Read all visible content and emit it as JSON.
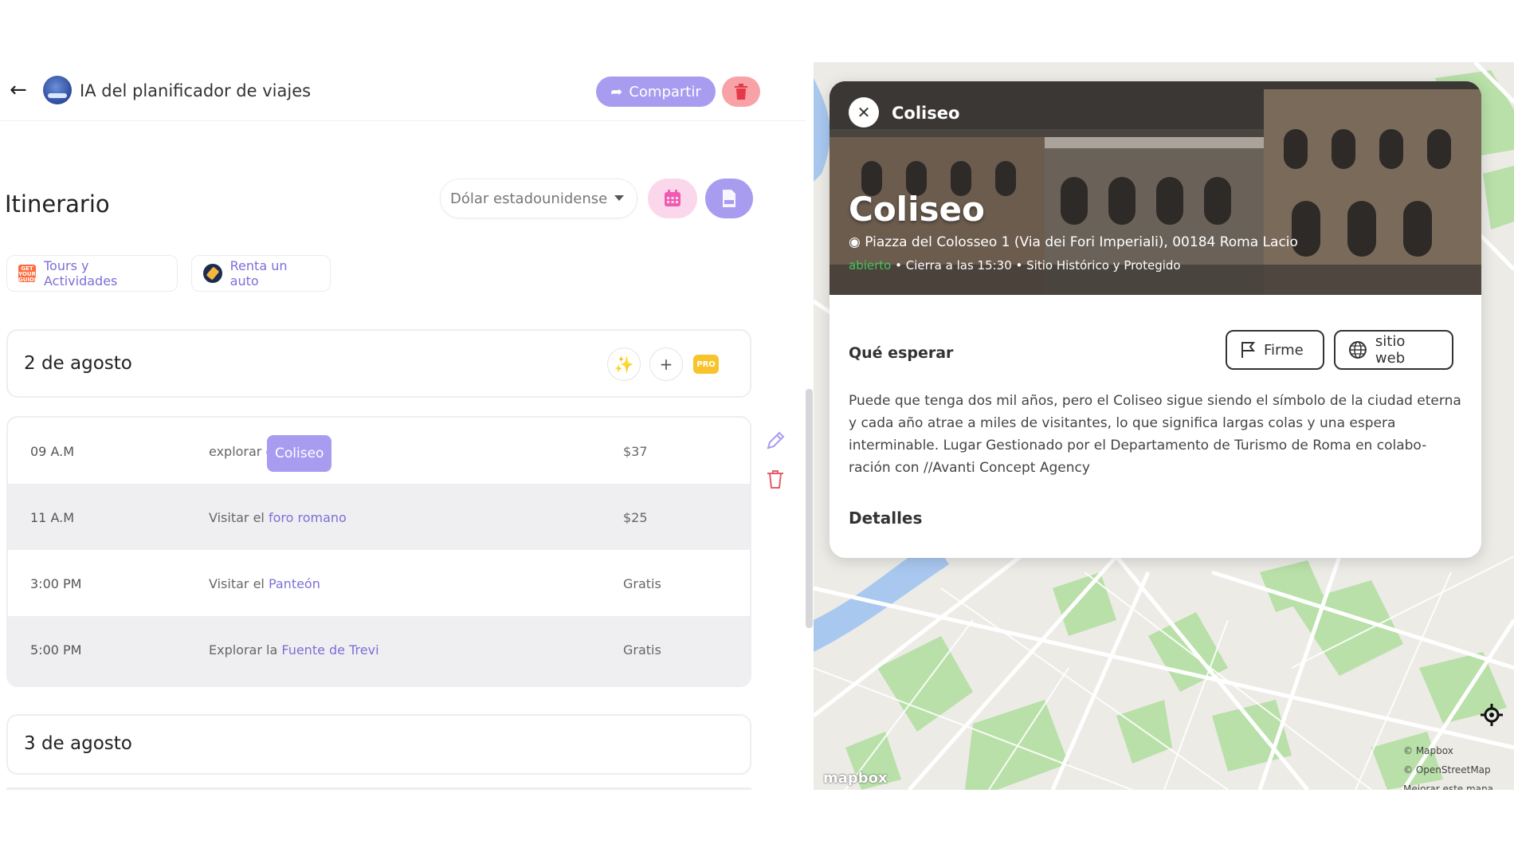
{
  "header": {
    "app_title": "IA del planificador de viajes",
    "share_label": "Compartir"
  },
  "itinerary": {
    "title": "Itinerario",
    "currency": "Dólar estadounidense"
  },
  "chips": {
    "tours_logo": "GET YOUR GUIDE",
    "tours_label": "Tours y Actividades",
    "car_label": "Renta un auto"
  },
  "days": [
    {
      "title": "2 de agosto",
      "pro_badge": "PRO",
      "activities": [
        {
          "time": "09 A.M",
          "prefix": "explorar e",
          "place": "",
          "price": "$37",
          "tooltip": "Coliseo"
        },
        {
          "time": "11 A.M",
          "prefix": "Visitar el ",
          "place": "foro romano",
          "price": "$25"
        },
        {
          "time": "3:00 PM",
          "prefix": "Visitar el ",
          "place": "Panteón",
          "price": "Gratis"
        },
        {
          "time": "5:00 PM",
          "prefix": "Explorar la ",
          "place": "Fuente de Trevi",
          "price": "Gratis"
        }
      ]
    },
    {
      "title": "3 de agosto"
    }
  ],
  "place_panel": {
    "name_small": "Coliseo",
    "name": "Coliseo",
    "address": "Piazza del Colosseo 1 (Via dei Fori Imperiali), 00184 Roma Lacio",
    "status_open": "abierto",
    "status_rest": " • Cierra a las 15:30 • Sitio Histórico y Protegido",
    "what_to_expect": "Qué esperar",
    "firme_label": "Firme",
    "web_label": "sitio web",
    "description": "Puede que tenga dos mil años, pero el Coliseo sigue siendo el símbolo de la ciudad eterna y cada año atrae a miles de visitantes, lo que significa largas colas y una espera interminable. Lugar Gestionado por el Departamento de Turismo de Roma en colabo-ración con //Avanti Concept Agency",
    "details_title": "Detalles"
  },
  "map": {
    "attribution_1": "© Mapbox",
    "attribution_2": "© OpenStreetMap",
    "attribution_3": "Mejorar este mapa",
    "logo": "mapbox"
  },
  "colors": {
    "accent": "#a89cf0",
    "link": "#7b6fd8",
    "danger": "#f8a1a6",
    "pro": "#f7c52b",
    "open": "#45c45d"
  }
}
